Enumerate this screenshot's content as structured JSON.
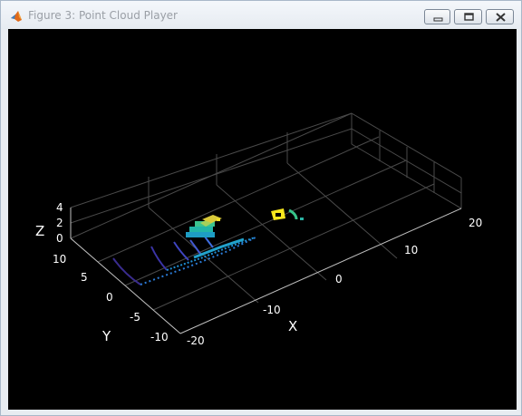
{
  "window": {
    "title": "Figure 3: Point Cloud Player",
    "icon": "matlab-icon",
    "controls": [
      "minimize-icon",
      "maximize-icon",
      "close-icon"
    ]
  },
  "plot": {
    "background": "#000000",
    "grid_color": "#4a4a4a",
    "axis_color": "#bfbfbf",
    "colormap": "parula",
    "x_label": "X",
    "y_label": "Y",
    "z_label": "Z",
    "x_ticks": [
      "-20",
      "-10",
      "0",
      "10",
      "20"
    ],
    "y_ticks": [
      "10",
      "5",
      "0",
      "-5",
      "-10"
    ],
    "z_ticks": [
      "4",
      "2",
      "0"
    ]
  }
}
